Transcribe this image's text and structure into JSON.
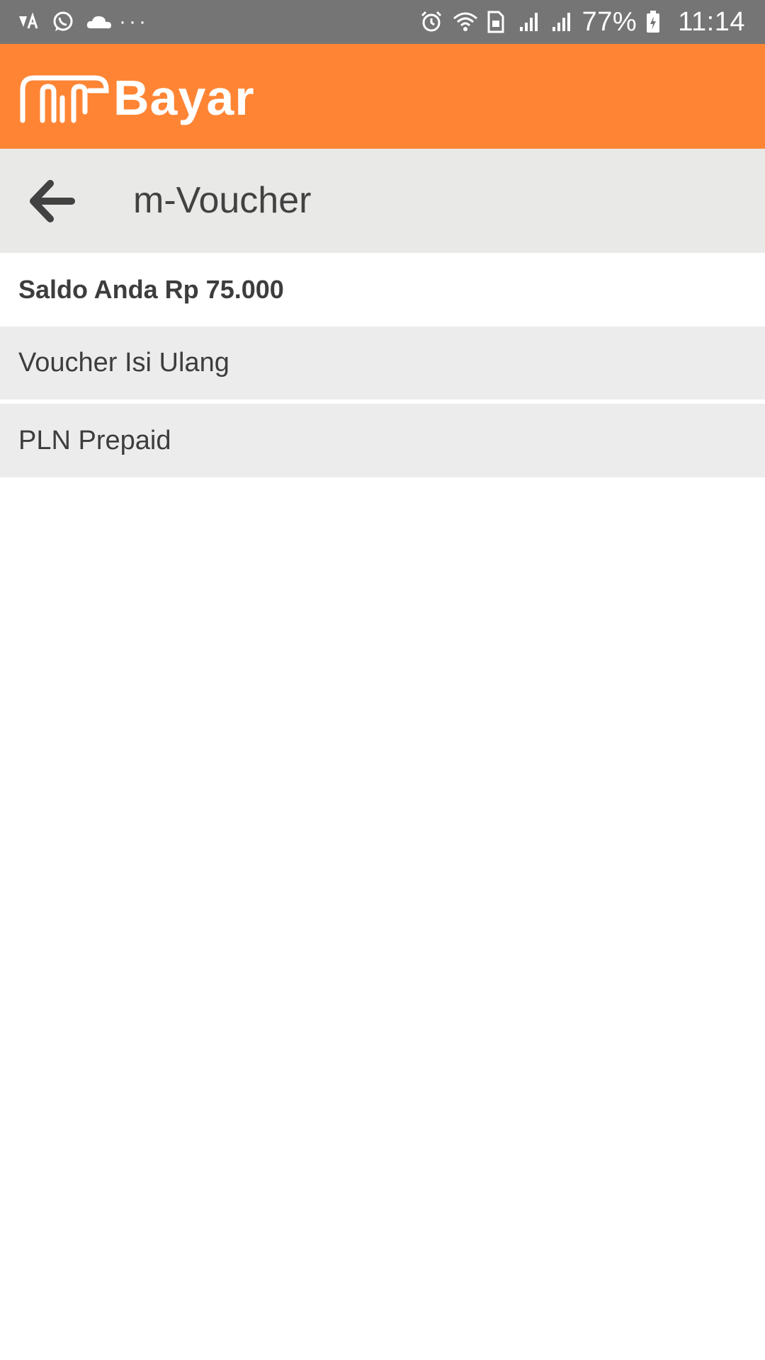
{
  "status_bar": {
    "battery_percent": "77%",
    "time": "11:14",
    "more_indicator": "···"
  },
  "app": {
    "logo_text": "Bayar",
    "accent_color": "#ff8535"
  },
  "toolbar": {
    "title": "m-Voucher"
  },
  "balance": {
    "label": "Saldo Anda Rp 75.000"
  },
  "menu": {
    "items": [
      {
        "label": "Voucher Isi Ulang"
      },
      {
        "label": "PLN Prepaid"
      }
    ]
  }
}
